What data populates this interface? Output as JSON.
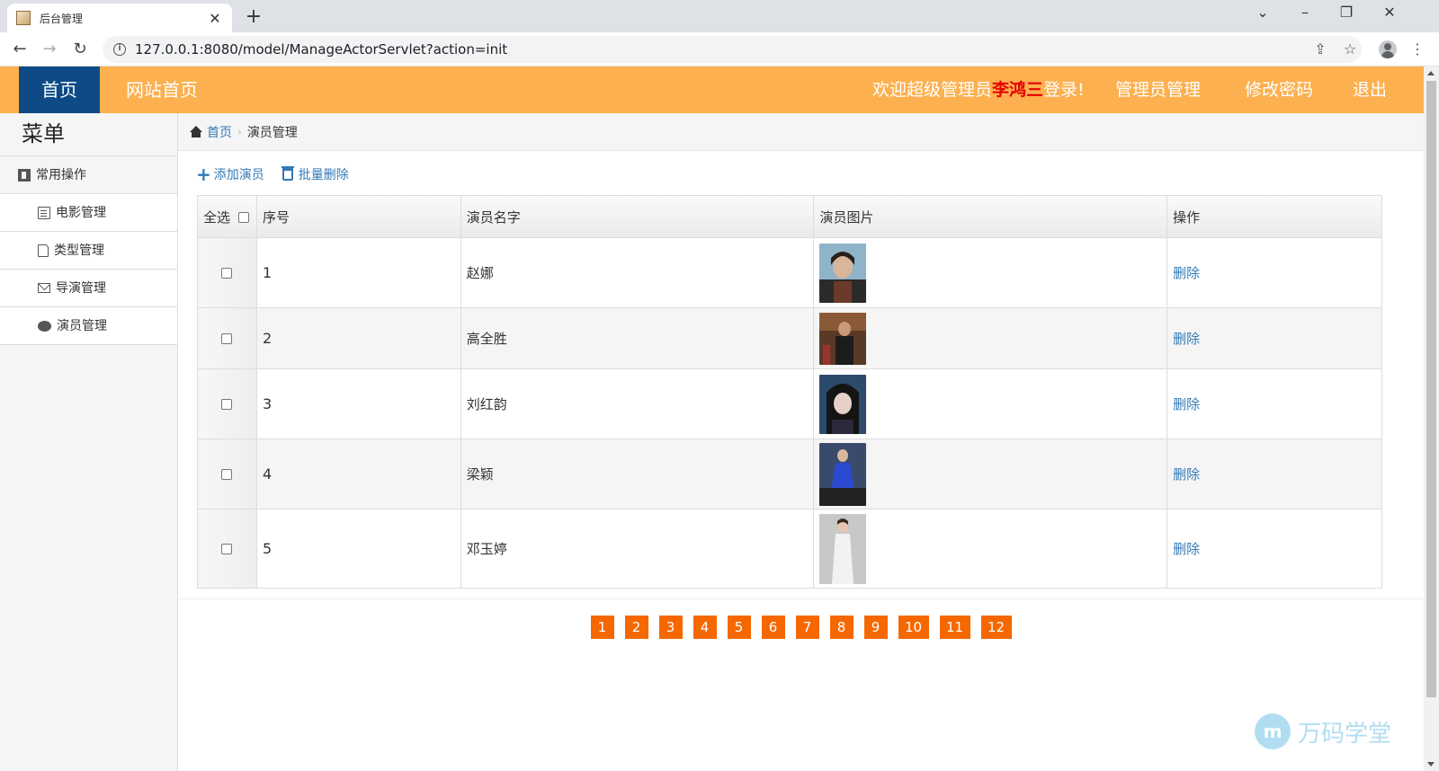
{
  "browser": {
    "tab_title": "后台管理",
    "tab_close": "✕",
    "new_tab": "+",
    "url": "127.0.0.1:8080/model/ManageActorServlet?action=init"
  },
  "header": {
    "home": "首页",
    "site_home": "网站首页",
    "welcome_prefix": "欢迎超级管理员",
    "admin_name": "李鸿三",
    "welcome_suffix": "登录!",
    "admin_manage": "管理员管理",
    "change_password": "修改密码",
    "logout": "退出",
    "colors": {
      "bar": "#fcb04f",
      "home_bg": "#0e4b86",
      "name": "#e60000"
    }
  },
  "sidebar": {
    "title": "菜单",
    "group": "常用操作",
    "items": [
      {
        "label": "电影管理",
        "icon": "document-icon"
      },
      {
        "label": "类型管理",
        "icon": "file-icon"
      },
      {
        "label": "导演管理",
        "icon": "envelope-icon"
      },
      {
        "label": "演员管理",
        "icon": "comment-icon"
      }
    ]
  },
  "breadcrumb": {
    "home": "首页",
    "current": "演员管理"
  },
  "toolbar": {
    "add": "添加演员",
    "batch_delete": "批量删除"
  },
  "table": {
    "columns": [
      "全选",
      "序号",
      "演员名字",
      "演员图片",
      "操作"
    ],
    "rows": [
      {
        "seq": "1",
        "name": "赵娜",
        "action": "删除"
      },
      {
        "seq": "2",
        "name": "高全胜",
        "action": "删除"
      },
      {
        "seq": "3",
        "name": "刘红韵",
        "action": "删除"
      },
      {
        "seq": "4",
        "name": "梁颖",
        "action": "删除"
      },
      {
        "seq": "5",
        "name": "邓玉婷",
        "action": "删除"
      }
    ]
  },
  "pagination": [
    "1",
    "2",
    "3",
    "4",
    "5",
    "6",
    "7",
    "8",
    "9",
    "10",
    "11",
    "12"
  ],
  "watermark": {
    "logo": "m",
    "text": "万码学堂"
  }
}
